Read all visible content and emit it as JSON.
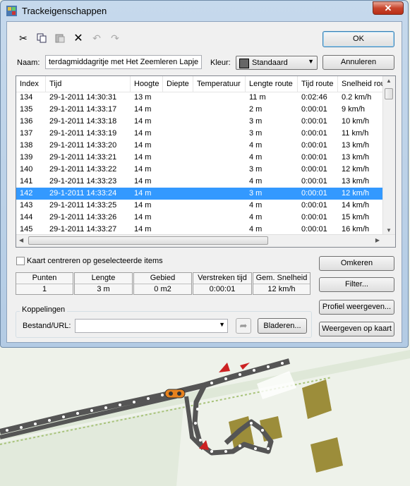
{
  "window": {
    "title": "Trackeigenschappen",
    "close_symbol": "✕"
  },
  "toolbar": {
    "icons": [
      "scissors-icon",
      "copy-icon",
      "paste-icon",
      "delete-icon",
      "undo-icon",
      "redo-icon"
    ]
  },
  "buttons": {
    "ok": "OK",
    "cancel": "Annuleren",
    "reverse": "Omkeren",
    "filter": "Filter...",
    "profile": "Profiel weergeven...",
    "show_on_map": "Weergeven op kaart",
    "browse": "Bladeren..."
  },
  "name": {
    "label": "Naam:",
    "value": "terdagmiddagritje met Het Zeemleren Lapje"
  },
  "color": {
    "label": "Kleur:",
    "value": "Standaard",
    "swatch": "#666666"
  },
  "table": {
    "columns": [
      "Index",
      "Tijd",
      "Hoogte",
      "Diepte",
      "Temperatuur",
      "Lengte route",
      "Tijd route",
      "Snelheid route"
    ],
    "selected_index": "142",
    "rows": [
      [
        "134",
        "29-1-2011 14:30:31",
        "13 m",
        "",
        "",
        "11 m",
        "0:02:46",
        "0.2 km/h"
      ],
      [
        "135",
        "29-1-2011 14:33:17",
        "14 m",
        "",
        "",
        "2 m",
        "0:00:01",
        "9 km/h"
      ],
      [
        "136",
        "29-1-2011 14:33:18",
        "14 m",
        "",
        "",
        "3 m",
        "0:00:01",
        "10 km/h"
      ],
      [
        "137",
        "29-1-2011 14:33:19",
        "14 m",
        "",
        "",
        "3 m",
        "0:00:01",
        "11 km/h"
      ],
      [
        "138",
        "29-1-2011 14:33:20",
        "14 m",
        "",
        "",
        "4 m",
        "0:00:01",
        "13 km/h"
      ],
      [
        "139",
        "29-1-2011 14:33:21",
        "14 m",
        "",
        "",
        "4 m",
        "0:00:01",
        "13 km/h"
      ],
      [
        "140",
        "29-1-2011 14:33:22",
        "14 m",
        "",
        "",
        "3 m",
        "0:00:01",
        "12 km/h"
      ],
      [
        "141",
        "29-1-2011 14:33:23",
        "14 m",
        "",
        "",
        "4 m",
        "0:00:01",
        "13 km/h"
      ],
      [
        "142",
        "29-1-2011 14:33:24",
        "14 m",
        "",
        "",
        "3 m",
        "0:00:01",
        "12 km/h"
      ],
      [
        "143",
        "29-1-2011 14:33:25",
        "14 m",
        "",
        "",
        "4 m",
        "0:00:01",
        "14 km/h"
      ],
      [
        "144",
        "29-1-2011 14:33:26",
        "14 m",
        "",
        "",
        "4 m",
        "0:00:01",
        "15 km/h"
      ],
      [
        "145",
        "29-1-2011 14:33:27",
        "14 m",
        "",
        "",
        "4 m",
        "0:00:01",
        "16 km/h"
      ]
    ]
  },
  "center_map": {
    "label": "Kaart centreren op geselecteerde items",
    "checked": false
  },
  "stats": {
    "headers": [
      "Punten",
      "Lengte",
      "Gebied",
      "Verstreken tijd",
      "Gem. Snelheid"
    ],
    "values": [
      "1",
      "3 m",
      "0 m2",
      "0:00:01",
      "12 km/h"
    ]
  },
  "links": {
    "group_label": "Koppelingen",
    "url_label": "Bestand/URL:",
    "url_value": ""
  }
}
